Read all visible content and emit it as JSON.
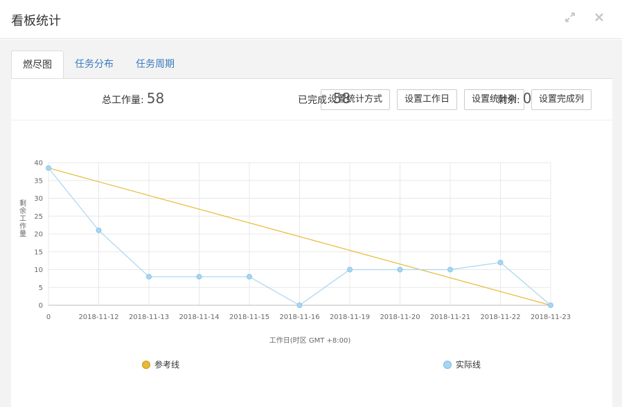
{
  "header": {
    "title": "看板统计"
  },
  "tabs": [
    {
      "label": "燃尽图",
      "active": true
    },
    {
      "label": "任务分布",
      "active": false
    },
    {
      "label": "任务周期",
      "active": false
    }
  ],
  "toolbar": {
    "stat_method": "设置统计方式",
    "workday": "设置工作日",
    "stat_columns": "设置统计列",
    "done_columns": "设置完成列"
  },
  "stats": {
    "total_label": "总工作量:",
    "total_value": "58",
    "done_label": "已完成:",
    "done_value": "58",
    "remain_label": "剩余:",
    "remain_value": "0"
  },
  "colors": {
    "reference": "#e8b933",
    "actual": "#a7d5f2",
    "link": "#3a7bbf"
  },
  "chart_data": {
    "type": "line",
    "x": [
      "0",
      "2018-11-12",
      "2018-11-13",
      "2018-11-14",
      "2018-11-15",
      "2018-11-16",
      "2018-11-19",
      "2018-11-20",
      "2018-11-21",
      "2018-11-22",
      "2018-11-23"
    ],
    "xlabel": "工作日(时区 GMT +8:00)",
    "ylabel": "剩余工作量",
    "ylim": [
      0,
      40
    ],
    "yticks": [
      0,
      5,
      10,
      15,
      20,
      25,
      30,
      35,
      40
    ],
    "grid": true,
    "legend_position": "bottom",
    "series": [
      {
        "name": "参考线",
        "values": [
          38.5,
          null,
          null,
          null,
          null,
          null,
          null,
          null,
          null,
          null,
          0
        ]
      },
      {
        "name": "实际线",
        "values": [
          38.5,
          21,
          8,
          8,
          8,
          0,
          10,
          10,
          10,
          12,
          0
        ]
      }
    ]
  }
}
